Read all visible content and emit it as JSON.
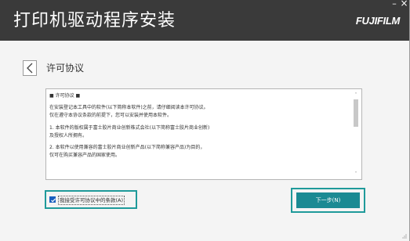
{
  "window": {
    "minimize_glyph": "–",
    "close_glyph": "×"
  },
  "header": {
    "title": "打印机驱动程序安装",
    "brand": "FUJIFILM"
  },
  "section": {
    "back_icon": "chevron-left-icon",
    "title": "许可协议"
  },
  "license": {
    "lines": [
      "■ 许可协议 ■",
      "",
      "在安装登记本工具中的软件(以下简称本软件)之前，请仔细阅读本许可协议。",
      "仅在遵守本协议条款的前提下，您可以安装并使用本软件。",
      "",
      "1. 本软件的版权属于富士胶片商业创新株式会社(以下简称富士胶片商业创新)",
      "   及授权人所拥有。",
      "",
      "2. 本软件以使用兼容的富士胶片商业创新产品(以下简称兼容产品)为目的，",
      "   仅可在购买兼容产品的国家使用。"
    ],
    "scroll_up_glyph": "˄",
    "scroll_down_glyph": "˅"
  },
  "agree": {
    "checked": true,
    "label": "我接受许可协议中的条款(A)"
  },
  "next_button": {
    "label": "下一步(N)"
  },
  "colors": {
    "header_bg": "#3a3a3a",
    "accent_teal": "#1b8a93",
    "highlight_outline": "#1f9a9a",
    "checkbox_blue": "#1a5fbf"
  }
}
